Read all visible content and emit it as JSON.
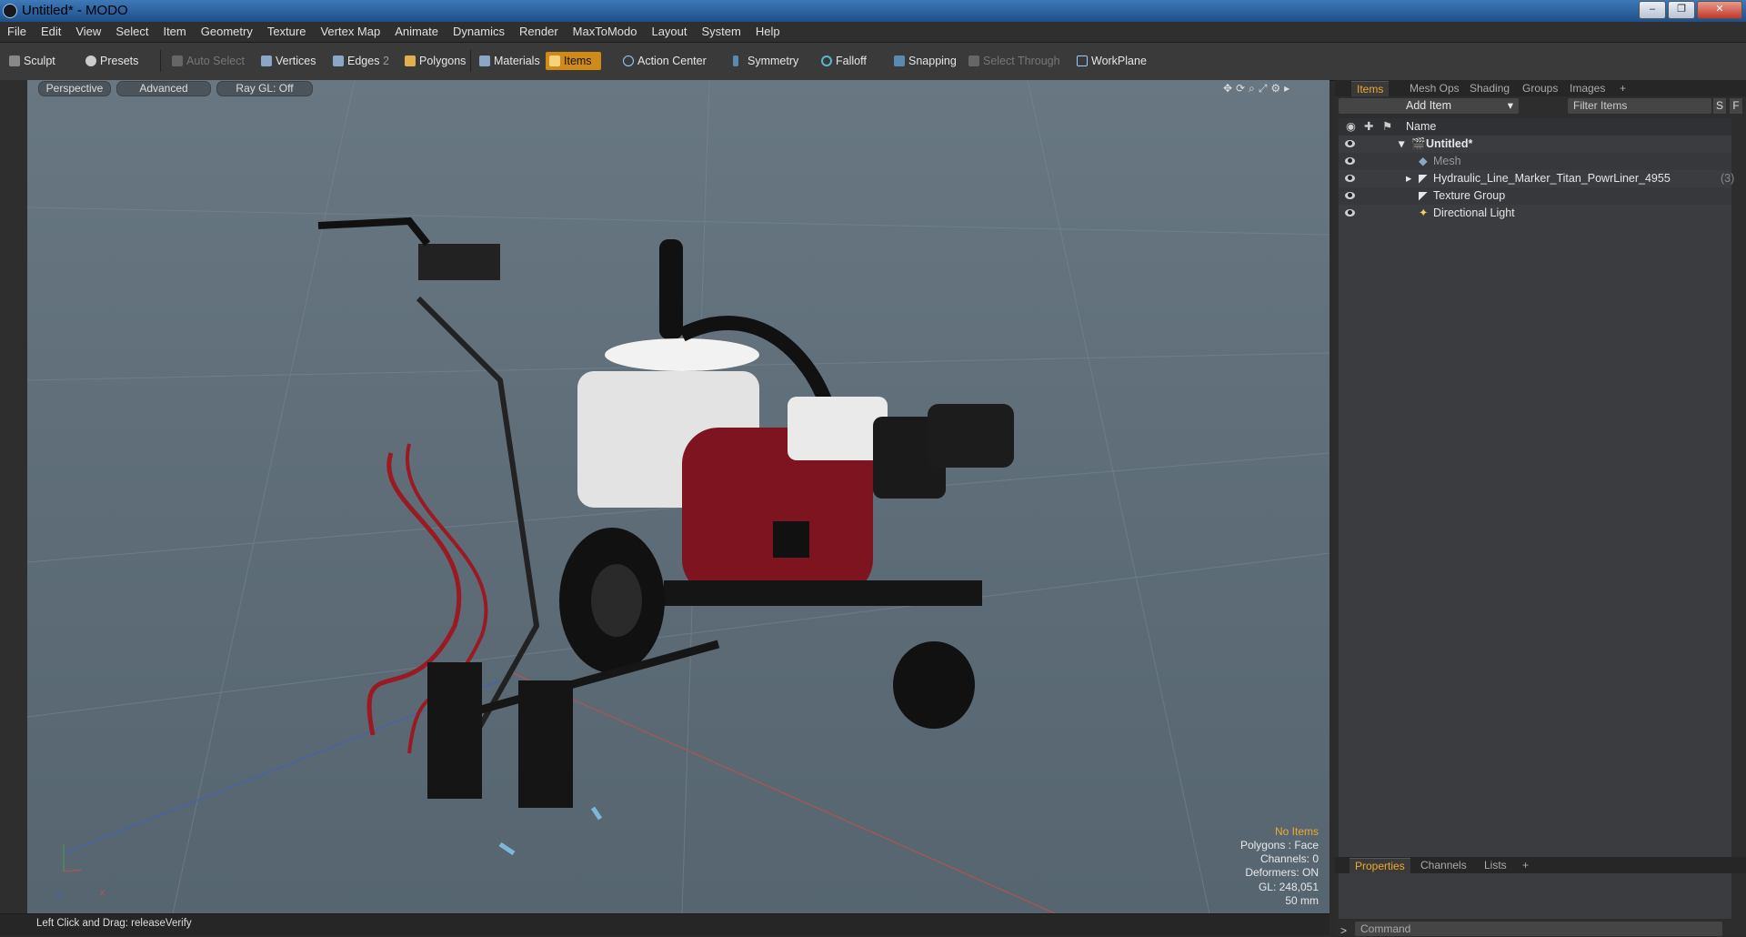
{
  "window": {
    "title": "Untitled* - MODO",
    "min": "–",
    "max": "❐",
    "close": "✕"
  },
  "menu": [
    "File",
    "Edit",
    "View",
    "Select",
    "Item",
    "Geometry",
    "Texture",
    "Vertex Map",
    "Animate",
    "Dynamics",
    "Render",
    "MaxToModo",
    "Layout",
    "System",
    "Help"
  ],
  "toolbar": {
    "sculpt": "Sculpt",
    "presets": "Presets",
    "auto_select": "Auto Select",
    "vertices": "Vertices",
    "edges": "Edges",
    "edges_count": "2",
    "polygons": "Polygons",
    "materials": "Materials",
    "items": "Items",
    "action_center": "Action Center",
    "symmetry": "Symmetry",
    "falloff": "Falloff",
    "snapping": "Snapping",
    "select_through": "Select Through",
    "workplane": "WorkPlane"
  },
  "viewport": {
    "tab_perspective": "Perspective",
    "tab_advanced": "Advanced",
    "tab_raygl": "Ray GL: Off",
    "info": {
      "no_items": "No Items",
      "polygons": "Polygons : Face",
      "channels": "Channels: 0",
      "deformers": "Deformers: ON",
      "gl": "GL: 248,051",
      "scale": "50 mm"
    },
    "axis_x": "x",
    "axis_z": "z"
  },
  "status": {
    "hint": "Left Click and Drag:  releaseVerify"
  },
  "items_panel": {
    "tabs": [
      "Items",
      "Mesh Ops",
      "Shading",
      "Groups",
      "Images",
      "+"
    ],
    "add_item": "Add Item",
    "filter_placeholder": "Filter Items",
    "s_btn": "S",
    "f_btn": "F",
    "col_name": "Name",
    "rows": [
      {
        "name": "Untitled*",
        "count": ""
      },
      {
        "name": "Mesh",
        "count": ""
      },
      {
        "name": "Hydraulic_Line_Marker_Titan_PowrLiner_4955",
        "count": "(3)"
      },
      {
        "name": "Texture Group",
        "count": ""
      },
      {
        "name": "Directional Light",
        "count": ""
      }
    ]
  },
  "properties_panel": {
    "tabs": [
      "Properties",
      "Channels",
      "Lists",
      "+"
    ],
    "command_placeholder": "Command",
    "prompt": ">"
  },
  "colors": {
    "accent": "#f0a830",
    "viewport_bg": "#5e6d78",
    "machine_red": "#8a1420"
  }
}
